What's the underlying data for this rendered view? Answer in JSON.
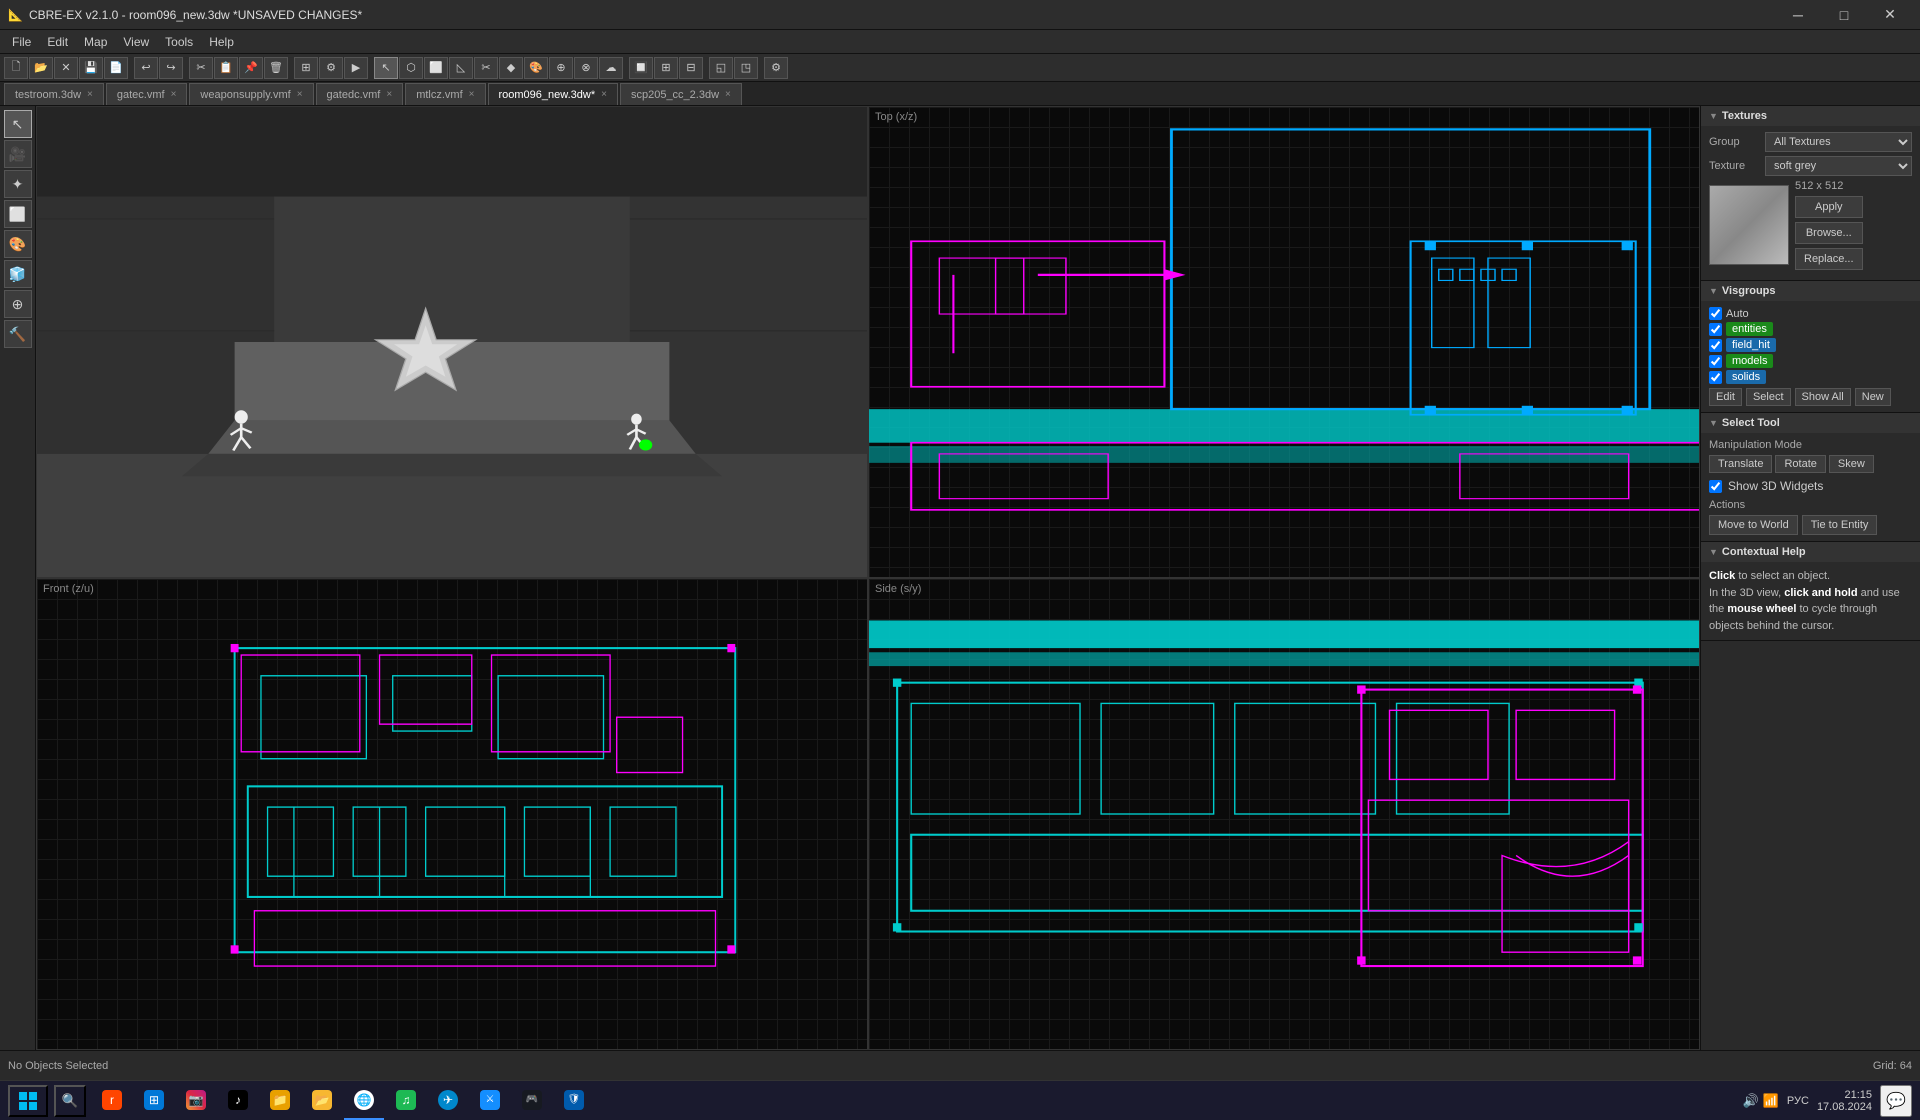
{
  "app": {
    "title": "CBRE-EX v2.1.0 - room096_new.3dw *UNSAVED CHANGES*",
    "icon": "📐"
  },
  "window_controls": {
    "minimize": "─",
    "maximize": "□",
    "close": "✕"
  },
  "menu": {
    "items": [
      "File",
      "Edit",
      "Map",
      "View",
      "Tools",
      "Help"
    ]
  },
  "tabs": [
    {
      "label": "testroom.3dw",
      "active": false,
      "closeable": true
    },
    {
      "label": "gatec.vmf",
      "active": false,
      "closeable": true
    },
    {
      "label": "weaponsupply.vmf",
      "active": false,
      "closeable": true
    },
    {
      "label": "gatedc.vmf",
      "active": false,
      "closeable": true
    },
    {
      "label": "mtlcz.vmf",
      "active": false,
      "closeable": true
    },
    {
      "label": "room096_new.3dw*",
      "active": true,
      "closeable": true
    },
    {
      "label": "scp205_cc_2.3dw",
      "active": false,
      "closeable": true
    }
  ],
  "viewports": {
    "top_left": {
      "label": ""
    },
    "top_right": {
      "label": "Top (x/z)"
    },
    "bottom_left": {
      "label": "Front (z/u)"
    },
    "bottom_right": {
      "label": "Side (s/y)"
    }
  },
  "right_panel": {
    "textures": {
      "header": "Textures",
      "group_label": "Group",
      "group_value": "All Textures",
      "texture_label": "Texture",
      "texture_value": "soft grey",
      "size": "512 x 512",
      "apply_btn": "Apply",
      "browse_btn": "Browse...",
      "replace_btn": "Replace..."
    },
    "visgroups": {
      "header": "Visgroups",
      "auto_label": "Auto",
      "items": [
        {
          "label": "entities",
          "checked": true,
          "badge": "entities",
          "badge_class": "badge-entities"
        },
        {
          "label": "field_hit",
          "checked": true,
          "badge": "field_hit",
          "badge_class": "badge-field-hit"
        },
        {
          "label": "models",
          "checked": true,
          "badge": "models",
          "badge_class": "badge-models"
        },
        {
          "label": "solids",
          "checked": true,
          "badge": "solids",
          "badge_class": "badge-solids"
        }
      ],
      "edit_btn": "Edit",
      "select_btn": "Select",
      "show_all_btn": "Show All",
      "new_btn": "New"
    },
    "select_tool": {
      "header": "Select Tool",
      "manipulation_label": "Manipulation Mode",
      "translate_btn": "Translate",
      "rotate_btn": "Rotate",
      "skew_btn": "Skew",
      "show_3d_label": "Show 3D Widgets",
      "actions_label": "Actions",
      "move_to_world_btn": "Move to World",
      "tie_to_entity_btn": "Tie to Entity"
    },
    "contextual_help": {
      "header": "Contextual Help",
      "text_bold": "Click",
      "text1": " to select an object.",
      "text2": "In the 3D view, ",
      "text3_bold": "click and hold",
      "text4": " and use the ",
      "text5_bold": "mouse wheel",
      "text6": " to cycle through objects behind the cursor."
    }
  },
  "statusbar": {
    "status": "No Objects Selected",
    "grid": "Grid: 64"
  },
  "taskbar": {
    "time": "21:15",
    "date": "17.08.2024",
    "language": "РУС",
    "apps": [
      "🪟",
      "🔍",
      "reddit",
      "📦",
      "📷",
      "🎵",
      "🌐",
      "🎮",
      "♪",
      "🎯",
      "🚂",
      "🔒"
    ]
  }
}
